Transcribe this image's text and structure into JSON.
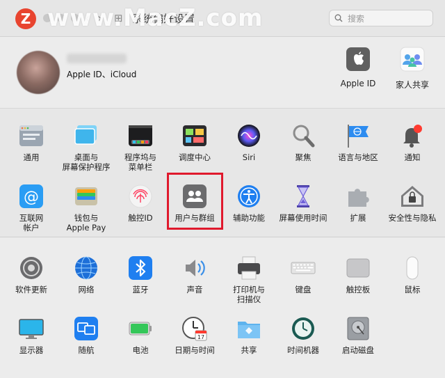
{
  "window": {
    "title": "系统偏好设置"
  },
  "watermark": {
    "logo_letter": "Z",
    "text": "www.MacZ.com"
  },
  "nav": {
    "back": "‹",
    "forward": "›",
    "grid": "⊞"
  },
  "search": {
    "placeholder": "搜索"
  },
  "account": {
    "subtitle": "Apple ID、iCloud"
  },
  "top_items": [
    {
      "label": "Apple ID",
      "icon": "apple-logo-icon"
    },
    {
      "label": "家人共享",
      "icon": "family-sharing-icon"
    }
  ],
  "row1": [
    {
      "l1": "通用",
      "l2": "",
      "icon": "general-icon"
    },
    {
      "l1": "桌面与",
      "l2": "屏幕保护程序",
      "icon": "desktop-screensaver-icon"
    },
    {
      "l1": "程序坞与",
      "l2": "菜单栏",
      "icon": "dock-menubar-icon"
    },
    {
      "l1": "调度中心",
      "l2": "",
      "icon": "mission-control-icon"
    },
    {
      "l1": "Siri",
      "l2": "",
      "icon": "siri-icon"
    },
    {
      "l1": "聚焦",
      "l2": "",
      "icon": "spotlight-icon"
    },
    {
      "l1": "语言与地区",
      "l2": "",
      "icon": "language-region-icon"
    },
    {
      "l1": "通知",
      "l2": "",
      "icon": "notifications-icon"
    }
  ],
  "row2": [
    {
      "l1": "互联网",
      "l2": "帐户",
      "icon": "internet-accounts-icon"
    },
    {
      "l1": "钱包与",
      "l2": "Apple Pay",
      "icon": "wallet-icon"
    },
    {
      "l1": "触控ID",
      "l2": "",
      "icon": "touch-id-icon"
    },
    {
      "l1": "用户与群组",
      "l2": "",
      "icon": "users-groups-icon"
    },
    {
      "l1": "辅助功能",
      "l2": "",
      "icon": "accessibility-icon"
    },
    {
      "l1": "屏幕使用时间",
      "l2": "",
      "icon": "screen-time-icon"
    },
    {
      "l1": "扩展",
      "l2": "",
      "icon": "extensions-icon"
    },
    {
      "l1": "安全性与隐私",
      "l2": "",
      "icon": "security-privacy-icon"
    }
  ],
  "row3": [
    {
      "l1": "软件更新",
      "l2": "",
      "icon": "software-update-icon"
    },
    {
      "l1": "网络",
      "l2": "",
      "icon": "network-icon"
    },
    {
      "l1": "蓝牙",
      "l2": "",
      "icon": "bluetooth-icon"
    },
    {
      "l1": "声音",
      "l2": "",
      "icon": "sound-icon"
    },
    {
      "l1": "打印机与",
      "l2": "扫描仪",
      "icon": "printer-scanner-icon"
    },
    {
      "l1": "键盘",
      "l2": "",
      "icon": "keyboard-icon"
    },
    {
      "l1": "触控板",
      "l2": "",
      "icon": "trackpad-icon"
    },
    {
      "l1": "鼠标",
      "l2": "",
      "icon": "mouse-icon"
    }
  ],
  "row4": [
    {
      "l1": "显示器",
      "l2": "",
      "icon": "displays-icon"
    },
    {
      "l1": "随航",
      "l2": "",
      "icon": "sidecar-icon"
    },
    {
      "l1": "电池",
      "l2": "",
      "icon": "battery-icon"
    },
    {
      "l1": "日期与时间",
      "l2": "",
      "icon": "date-time-icon"
    },
    {
      "l1": "共享",
      "l2": "",
      "icon": "sharing-icon"
    },
    {
      "l1": "时间机器",
      "l2": "",
      "icon": "time-machine-icon"
    },
    {
      "l1": "启动磁盘",
      "l2": "",
      "icon": "startup-disk-icon"
    }
  ],
  "calendar_day": "17"
}
